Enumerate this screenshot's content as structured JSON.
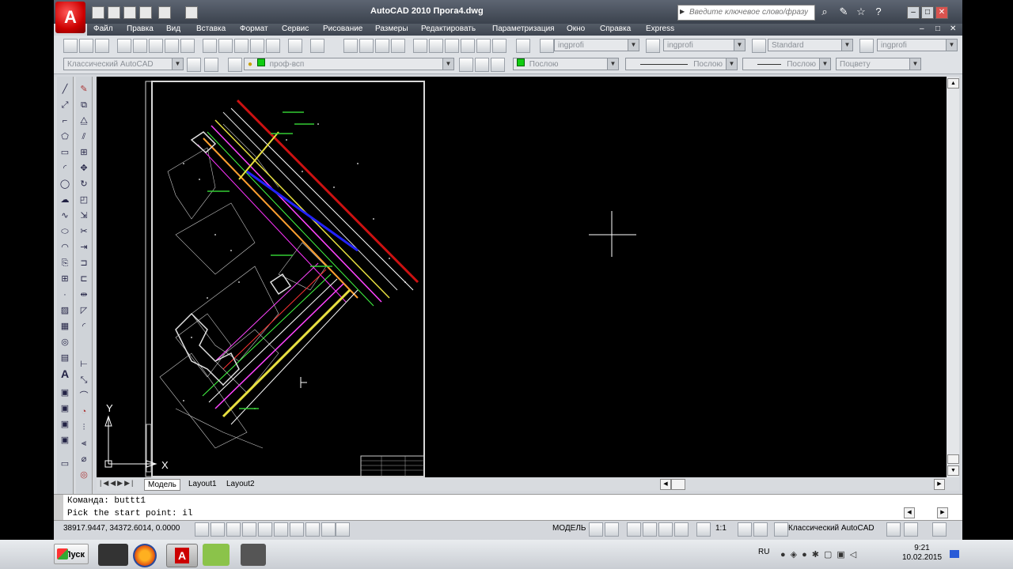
{
  "window": {
    "title": "AutoCAD 2010     Прога4.dwg",
    "app_button": "A",
    "search_placeholder": "Введите ключевое слово/фразу",
    "controls": [
      "–",
      "□",
      "✕"
    ]
  },
  "menu": {
    "items": [
      "Файл",
      "Правка",
      "Вид",
      "Вставка",
      "Формат",
      "Сервис",
      "Рисование",
      "Размеры",
      "Редактировать",
      "Параметризация",
      "Окно",
      "Справка",
      "Express"
    ],
    "doc_controls": [
      "–",
      "□",
      "✕"
    ]
  },
  "toolbar1": {
    "text_style": "ingprofi",
    "dim_style": "ingprofi",
    "table_style": "Standard",
    "mleader_style": "ingprofi"
  },
  "toolbar2": {
    "workspace": "Классический AutoCAD",
    "layer": "проф-всп",
    "color": "Послою",
    "linetype": "Послою",
    "lineweight": "Послою",
    "plotstyle": "Поцвету"
  },
  "ucs": {
    "y_label": "Y",
    "x_label": "X"
  },
  "tabs": {
    "model": "Модель",
    "layout1": "Layout1",
    "layout2": "Layout2"
  },
  "command": {
    "line1": "Команда: buttt1",
    "line2": "Pick the start point: il"
  },
  "status": {
    "coords": "38917.9447, 34372.6014, 0.0000",
    "model": "МОДЕЛЬ",
    "scale": "1:1",
    "workspace": "Классический AutoCAD"
  },
  "taskbar": {
    "start": "Пуск",
    "lang": "RU",
    "time": "9:21",
    "date": "10.02.2015"
  },
  "colors": {
    "title_bg": "#4a515c",
    "canvas": "#000000",
    "accent_red": "#c00000"
  }
}
